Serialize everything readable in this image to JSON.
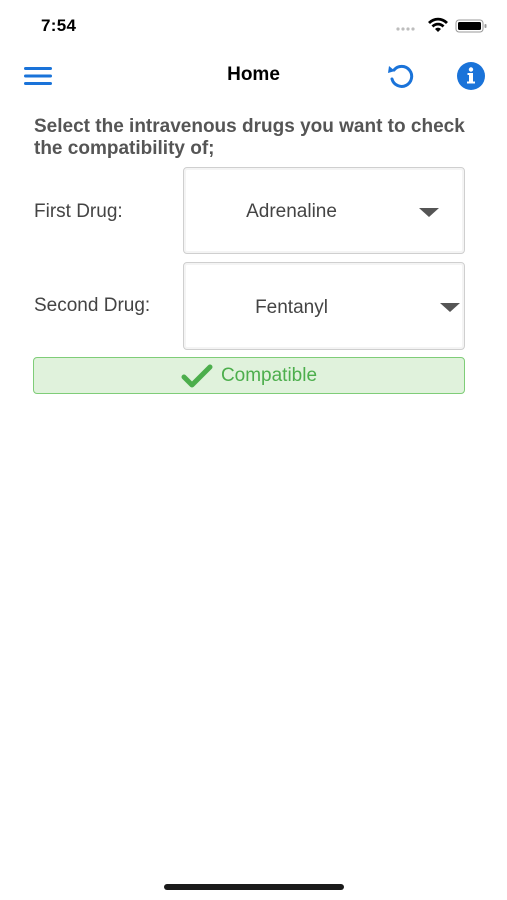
{
  "status_bar": {
    "time": "7:54"
  },
  "nav": {
    "title": "Home",
    "left_icon": "menu-icon",
    "right_icons": [
      "reset-icon",
      "info-icon"
    ],
    "accent_color": "#1a73d9"
  },
  "form": {
    "instruction": "Select the intravenous drugs you want to check the compatibility of;",
    "first_drug": {
      "label": "First Drug:",
      "value": "Adrenaline"
    },
    "second_drug": {
      "label": "Second Drug:",
      "value": "Fentanyl"
    }
  },
  "result": {
    "text": "Compatible",
    "icon": "check-icon",
    "color": "#4cae4c",
    "background": "#e0f2dc"
  }
}
